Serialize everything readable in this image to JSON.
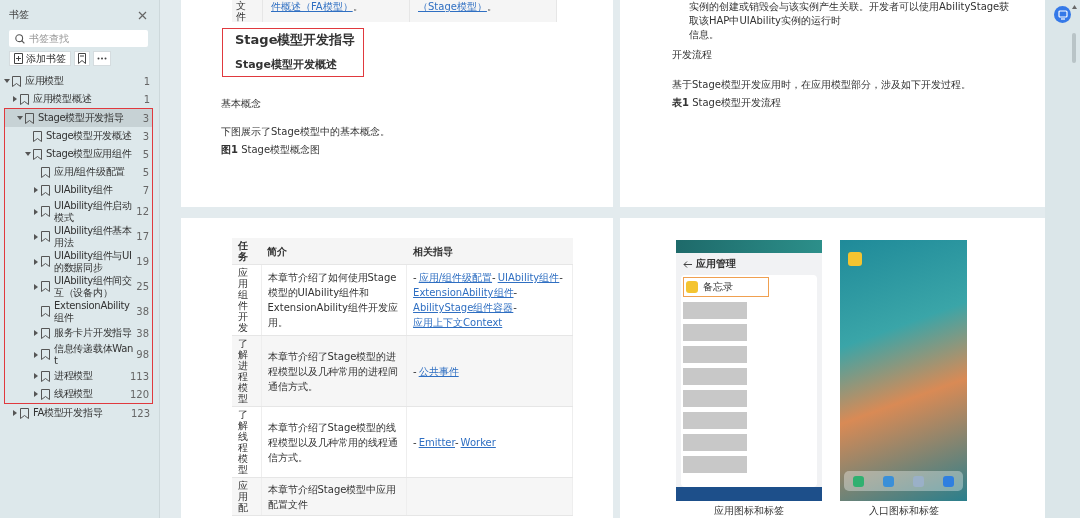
{
  "sidebar": {
    "title": "书签",
    "search": {
      "placeholder": "书签查找"
    },
    "add_button": "添加书签",
    "bookmarks": [
      {
        "title": "应用模型",
        "page": "1",
        "expandable": true,
        "expanded": true,
        "selected": false,
        "highlighted": false,
        "children": [
          {
            "title": "应用模型概述",
            "page": "1",
            "expandable": true,
            "expanded": false,
            "selected": false,
            "highlighted": false
          },
          {
            "title": "Stage模型开发指导",
            "page": "3",
            "expandable": true,
            "expanded": true,
            "selected": true,
            "highlighted": true,
            "children": [
              {
                "title": "Stage模型开发概述",
                "page": "3",
                "expandable": false,
                "expanded": false,
                "selected": false,
                "highlighted": false
              },
              {
                "title": "Stage模型应用组件",
                "page": "5",
                "expandable": true,
                "expanded": true,
                "selected": false,
                "highlighted": false,
                "children": [
                  {
                    "title": "应用/组件级配置",
                    "page": "5",
                    "expandable": false,
                    "expanded": false,
                    "selected": false,
                    "highlighted": false
                  },
                  {
                    "title": "UIAbility组件",
                    "page": "7",
                    "expandable": true,
                    "expanded": false,
                    "selected": false,
                    "highlighted": false
                  },
                  {
                    "title": "UIAbility组件启动模式",
                    "page": "12",
                    "expandable": true,
                    "expanded": false,
                    "selected": false,
                    "highlighted": false
                  },
                  {
                    "title": "UIAbility组件基本用法",
                    "page": "17",
                    "expandable": true,
                    "expanded": false,
                    "selected": false,
                    "highlighted": false
                  },
                  {
                    "title": "UIAbility组件与UI的数据同步",
                    "page": "19",
                    "expandable": true,
                    "expanded": false,
                    "selected": false,
                    "highlighted": false
                  },
                  {
                    "title": "UIAbility组件间交互（设备内）",
                    "page": "25",
                    "expandable": true,
                    "expanded": false,
                    "selected": false,
                    "highlighted": false
                  },
                  {
                    "title": "ExtensionAbility组件",
                    "page": "38",
                    "expandable": false,
                    "expanded": false,
                    "selected": false,
                    "highlighted": false
                  },
                  {
                    "title": "服务卡片开发指导",
                    "page": "38",
                    "expandable": true,
                    "expanded": false,
                    "selected": false,
                    "highlighted": false
                  },
                  {
                    "title": "信息传递载体Want",
                    "page": "98",
                    "expandable": true,
                    "expanded": false,
                    "selected": false,
                    "highlighted": false
                  },
                  {
                    "title": "进程模型",
                    "page": "113",
                    "expandable": true,
                    "expanded": false,
                    "selected": false,
                    "highlighted": false
                  },
                  {
                    "title": "线程模型",
                    "page": "120",
                    "expandable": true,
                    "expanded": false,
                    "selected": false,
                    "highlighted": false
                  }
                ]
              }
            ]
          },
          {
            "title": "FA模型开发指导",
            "page": "123",
            "expandable": true,
            "expanded": false,
            "selected": false,
            "highlighted": false
          }
        ]
      }
    ]
  },
  "document": {
    "top_left_page": {
      "table_fragment": [
        {
          "kind": "vertical",
          "text": "文件"
        },
        {
          "kind": "link",
          "text": "件概述（FA模型）",
          "suffix": "。"
        },
        {
          "kind": "link",
          "text": "（Stage模型）",
          "suffix": "。"
        }
      ],
      "headings": {
        "highlighted": true,
        "items": [
          {
            "kind": "h1",
            "text": "Stage模型开发指导"
          },
          {
            "kind": "h2",
            "text": "Stage模型开发概述"
          }
        ]
      },
      "paragraphs": [
        {
          "kind": "section",
          "text": "基本概念"
        },
        {
          "kind": "body",
          "text": "下图展示了Stage模型中的基本概念。"
        },
        {
          "kind": "caption",
          "text": "**图1** Stage模型概念图"
        }
      ]
    },
    "top_right_page": {
      "paragraphs": [
        {
          "kind": "indent",
          "text": "实例的创建或销毁会与该实例产生关联。开发者可以使用AbilityStage获取该HAP中UIAbility实例的运行时"
        },
        {
          "kind": "indent",
          "text": "信息。"
        },
        {
          "kind": "section",
          "text": "开发流程"
        },
        {
          "kind": "body",
          "text": "基于Stage模型开发应用时，在应用模型部分，涉及如下开发过程。"
        },
        {
          "kind": "caption",
          "text": "**表1** Stage模型开发流程"
        }
      ]
    },
    "table_page": {
      "columns": [
        "任务",
        "简介",
        "相关指导"
      ],
      "bullet": "-",
      "rows": [
        {
          "task": "应用组件开发",
          "summary": "本章节介绍了如何使用Stage模型的UIAbility组件和ExtensionAbility组件开发应用。",
          "links": [
            "应用/组件级配置",
            "UIAbility组件",
            "ExtensionAbility组件",
            "AbilityStage组件容器",
            "应用上下文Context"
          ]
        },
        {
          "task": "了解进程模型",
          "summary": "本章节介绍了Stage模型的进程模型以及几种常用的进程间通信方式。",
          "links": [
            "公共事件"
          ]
        },
        {
          "task": "了解线程模型",
          "summary": "本章节介绍了Stage模型的线程模型以及几种常用的线程通信方式。",
          "links": [
            "Emitter",
            "Worker"
          ]
        },
        {
          "task": "应用配",
          "summary": "本章节介绍Stage模型中应用配置文件",
          "links": []
        }
      ]
    },
    "figure_page": {
      "figures": [
        {
          "kind": "app_list",
          "caption": "应用图标和标签",
          "header": "应用管理",
          "app_name": "备忘录"
        },
        {
          "kind": "home_screen",
          "caption": "入口图标和标签"
        }
      ]
    }
  }
}
